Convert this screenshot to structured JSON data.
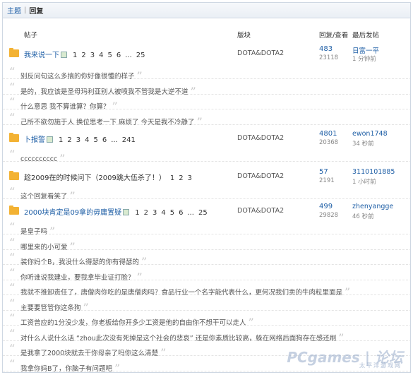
{
  "tabs": {
    "a": "主题",
    "sep": "|",
    "b": "回复"
  },
  "header": {
    "topic": "帖子",
    "forum": "版块",
    "stats": "回复/查看",
    "last": "最后发帖"
  },
  "threads": [
    {
      "title": "我来说一下",
      "plain": false,
      "pages": [
        "1",
        "2",
        "3",
        "4",
        "5",
        "6",
        "...",
        "25"
      ],
      "forum": "DOTA&DOTA2",
      "replies": "483",
      "views": "23118",
      "user": "日富一平",
      "time": "1 分钟前"
    },
    {
      "title": "卜报警",
      "plain": false,
      "pages": [
        "1",
        "2",
        "3",
        "4",
        "5",
        "6",
        "...",
        "241"
      ],
      "forum": "DOTA&DOTA2",
      "replies": "4801",
      "views": "20368",
      "user": "ewon1748",
      "time": "34 秒前"
    },
    {
      "title": "趁2009在的时候问下（2009跳大伍杀了！）",
      "plain": true,
      "pages": [
        "1",
        "2",
        "3"
      ],
      "forum": "DOTA&DOTA2",
      "replies": "57",
      "views": "2191",
      "user": "3110101885",
      "time": "1 小时前"
    },
    {
      "title": "2000块肯定是09拿的毋庸置疑",
      "plain": false,
      "pages": [
        "1",
        "2",
        "3",
        "4",
        "5",
        "6",
        "...",
        "25"
      ],
      "forum": "DOTA&DOTA2",
      "replies": "499",
      "views": "29828",
      "user": "zhenyangge",
      "time": "46 秒前"
    }
  ],
  "replies1": [
    "别反问句这么多搞的你好像很懂的样子",
    "是的，我应该是圣母玛利亚别人被喷我不管我是大逆不道",
    "什么意思 我不算谁算？你算？",
    "己所不欲勿施于人 换位思考一下 麻烦了 今天是我不冷静了"
  ],
  "replies2": [
    "cccccccccc"
  ],
  "replies3": [
    "这个回复看笑了"
  ],
  "replies4": [
    "是皇子吗",
    "哪里来的小可爱",
    "装你妈个B，我没什么得瑟的你有得瑟的",
    "你听谁说我建业，要我拿毕业证打脸？",
    "我就不推卸责任了，唐僧肉你吃的是唐僧肉吗？食品行业一个名字能代表什么，更何况我们卖的牛肉粒里面是",
    "主要要管管你这条狗",
    "工资曾应的1分没少发，你老板给你开多少工资是他的自由你不想干可以走人",
    "对什么人说什么话 “zhou此次没有死掉是这个社会的悲哀” 还是你素质比较高，躲在网络后面狗存在感还刷",
    "是我拿了2000块就去干你母亲了吗你这么清楚",
    "我拿你妈B了，你脑子有问题吧"
  ],
  "watermark": {
    "main": "PCgames | 论坛",
    "sub": "太平洋游戏网"
  }
}
